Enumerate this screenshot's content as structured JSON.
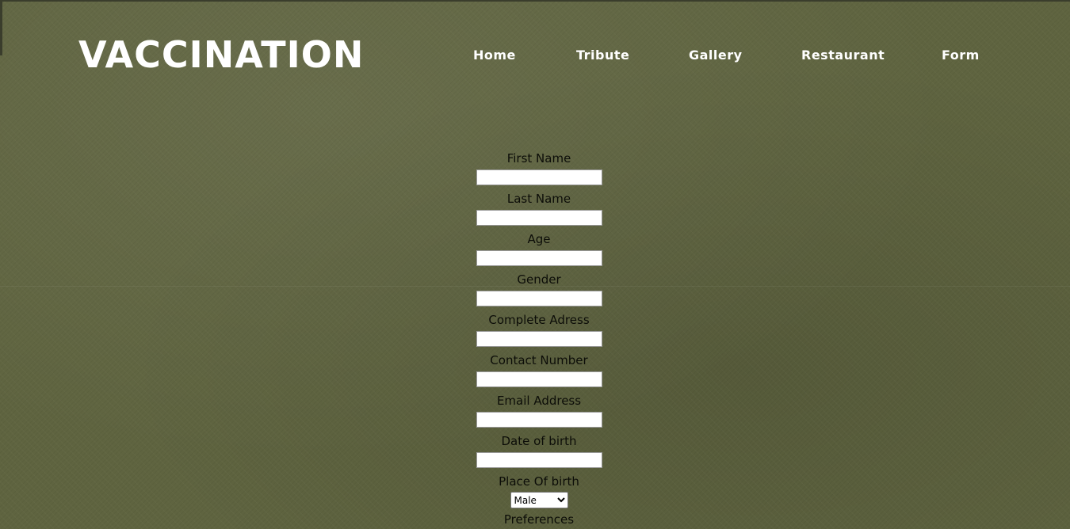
{
  "header": {
    "logo": "VACCINATION",
    "nav": [
      {
        "label": "Home"
      },
      {
        "label": "Tribute"
      },
      {
        "label": "Gallery"
      },
      {
        "label": "Restaurant"
      },
      {
        "label": "Form"
      }
    ]
  },
  "form": {
    "fields": [
      {
        "label": "First Name",
        "value": ""
      },
      {
        "label": "Last Name",
        "value": ""
      },
      {
        "label": "Age",
        "value": ""
      },
      {
        "label": "Gender",
        "value": ""
      },
      {
        "label": "Complete Adress",
        "value": ""
      },
      {
        "label": "Contact Number",
        "value": ""
      },
      {
        "label": "Email Address",
        "value": ""
      },
      {
        "label": "Date of birth",
        "value": ""
      }
    ],
    "place_of_birth_label": "Place Of birth",
    "select_value": "Male",
    "preferences_label": "Preferences"
  },
  "colors": {
    "background": "#5f6440",
    "text": "#0c0d08",
    "header_text": "#ffffff"
  }
}
